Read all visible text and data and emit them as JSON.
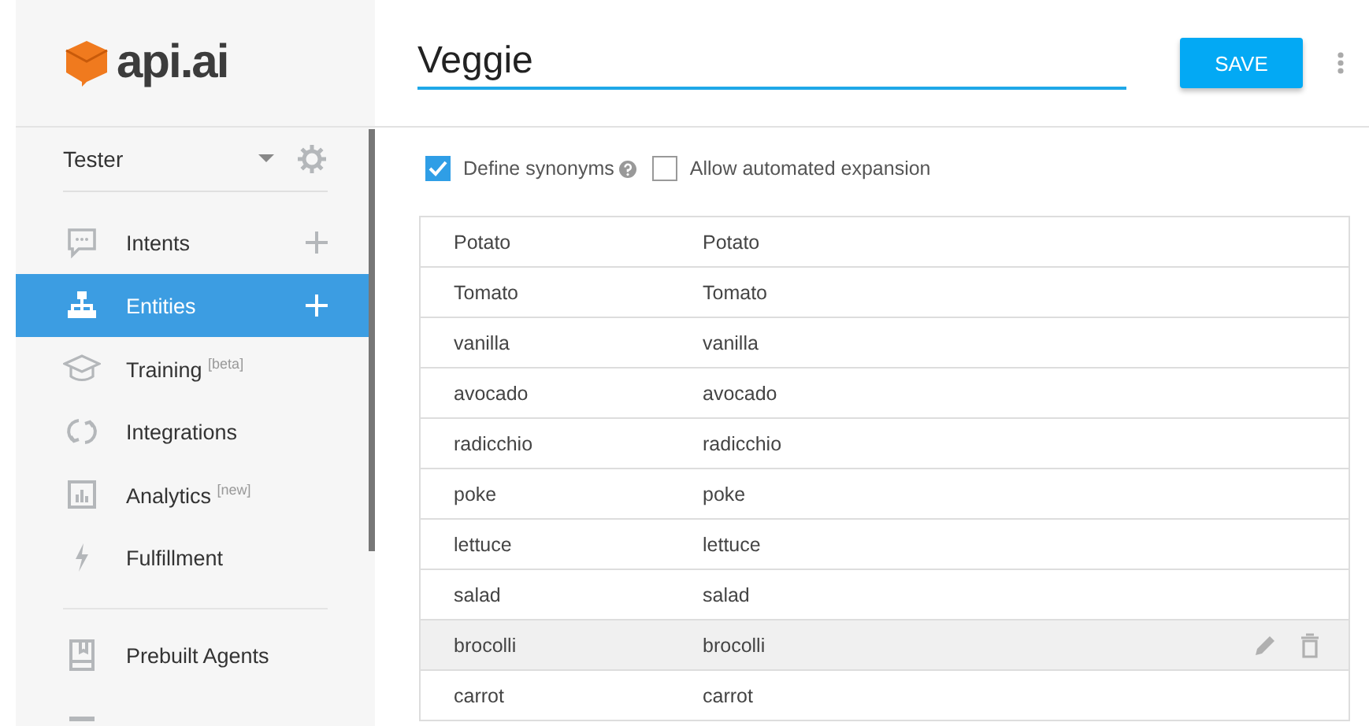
{
  "sidebar": {
    "logo": "api.ai",
    "agent": "Tester",
    "items": [
      {
        "kind": "chat",
        "label": "Intents",
        "add": true,
        "selected": false,
        "divider_before": false
      },
      {
        "kind": "tree",
        "label": "Entities",
        "add": true,
        "selected": true,
        "divider_before": false
      },
      {
        "kind": "cap",
        "label": "Training",
        "tag": "[beta]",
        "add": false,
        "selected": false,
        "divider_before": false
      },
      {
        "kind": "sync",
        "label": "Integrations",
        "add": false,
        "selected": false,
        "divider_before": false
      },
      {
        "kind": "chart",
        "label": "Analytics",
        "tag": "[new]",
        "add": false,
        "selected": false,
        "divider_before": false
      },
      {
        "kind": "bolt",
        "label": "Fulfillment",
        "add": false,
        "selected": false,
        "divider_before": false
      },
      {
        "kind": "book",
        "label": "Prebuilt Agents",
        "add": false,
        "selected": false,
        "divider_before": true
      }
    ]
  },
  "entity": {
    "name": "Veggie",
    "save": "SAVE"
  },
  "options": [
    {
      "label": "Define synonyms",
      "checked": true,
      "help": true
    },
    {
      "label": "Allow automated expansion",
      "checked": false,
      "help": false
    }
  ],
  "rows": [
    {
      "value": "Potato",
      "synonyms": "Potato",
      "hovered": false
    },
    {
      "value": "Tomato",
      "synonyms": "Tomato",
      "hovered": false
    },
    {
      "value": "vanilla",
      "synonyms": "vanilla",
      "hovered": false
    },
    {
      "value": "avocado",
      "synonyms": "avocado",
      "hovered": false
    },
    {
      "value": "radicchio",
      "synonyms": "radicchio",
      "hovered": false
    },
    {
      "value": "poke",
      "synonyms": "poke",
      "hovered": false
    },
    {
      "value": "lettuce",
      "synonyms": "lettuce",
      "hovered": false
    },
    {
      "value": "salad",
      "synonyms": "salad",
      "hovered": false
    },
    {
      "value": "brocolli",
      "synonyms": "brocolli",
      "hovered": true
    },
    {
      "value": "carrot",
      "synonyms": "carrot",
      "hovered": false
    }
  ]
}
